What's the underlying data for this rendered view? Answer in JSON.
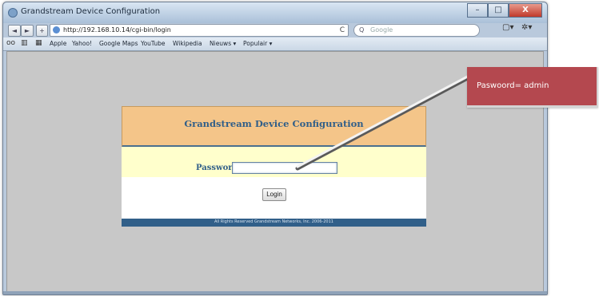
{
  "window": {
    "title": "Grandstream Device Configuration",
    "buttons": {
      "minimize": "–",
      "maximize": "□",
      "close": "X"
    }
  },
  "toolbar": {
    "back": "◄",
    "forward": "►",
    "add": "+",
    "url": "http://192.168.10.14/cgi-bin/login",
    "reload": "C",
    "search_prefix": "Q",
    "search_placeholder": "Google",
    "page_menu": "▢▾",
    "settings_menu": "✲▾"
  },
  "bookmarks": {
    "icons": [
      "oo",
      "▥",
      "▦"
    ],
    "items": [
      "Apple",
      "Yahoo!",
      "Google Maps",
      "YouTube",
      "Wikipedia",
      "Nieuws ▾",
      "Populair ▾"
    ]
  },
  "login": {
    "header_title": "Grandstream Device Configuration",
    "password_label": "Password",
    "password_value": "",
    "login_button": "Login",
    "footer": "All Rights Reserved Grandstream Networks, Inc. 2006-2011"
  },
  "callout": {
    "text": "Paswoord= admin",
    "color": "#b4484f"
  },
  "colors": {
    "header_bg": "#f4c589",
    "body_bg": "#ffffcc",
    "accent_blue": "#315f89",
    "content_gray": "#c8c8c8"
  }
}
